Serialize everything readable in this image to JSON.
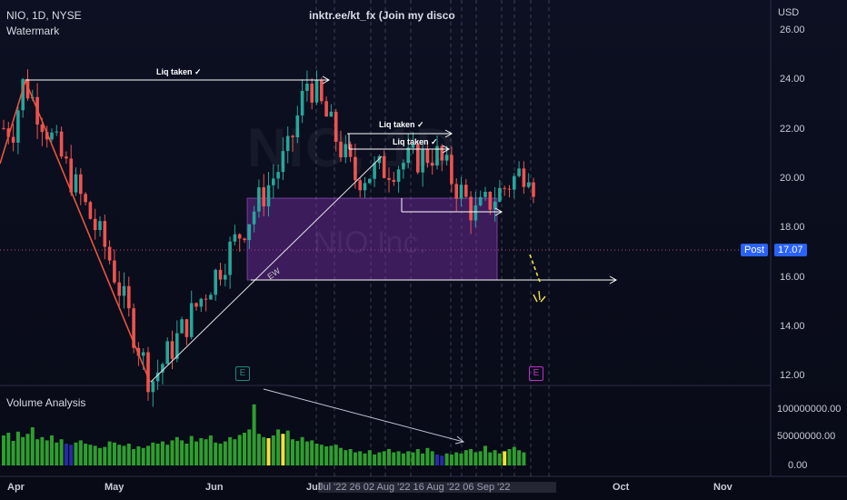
{
  "header": {
    "symbol_line": "NIO, 1D, NYSE",
    "watermark_label": "Watermark",
    "title_link": "inktr.ee/kt_fx (Join my disco",
    "currency": "USD"
  },
  "watermark": {
    "ticker": "NIO, 1D",
    "company": "NIO Inc."
  },
  "annotations": {
    "liq_taken_1": "Liq taken ✓",
    "liq_taken_2": "Liq taken ✓",
    "liq_taken_3": "Liq taken ✓",
    "ew_label": "EW",
    "earnings_1": "E",
    "earnings_2": "E"
  },
  "price_axis": {
    "ticks": [
      "26.00",
      "24.00",
      "22.00",
      "20.00",
      "18.00",
      "16.00",
      "14.00",
      "12.00"
    ]
  },
  "price_pill": {
    "label": "Post",
    "value": "17.07"
  },
  "volume_panel": {
    "title": "Volume Analysis",
    "ticks": [
      "100000000.00",
      "50000000.00",
      "0.00"
    ]
  },
  "time_axis": {
    "labels": [
      "Apr",
      "May",
      "Jun",
      "Jul",
      "Oct",
      "Nov"
    ],
    "dense_label": "Jul '22  26  02 Aug '22  16 Aug '22  06 Sep '22"
  },
  "colors": {
    "up": "#26a69a",
    "down": "#ef5350",
    "zone": "#7b2fa8",
    "vol_green": "#2e9e2e",
    "vol_blue": "#2a2aa6",
    "vol_yellow": "#f5e13a",
    "accent": "#2962ff"
  },
  "chart_data": {
    "type": "candlestick",
    "ylim": [
      11.5,
      27
    ],
    "ylabel": "USD",
    "points": [
      {
        "date": "Apr 1",
        "close": 22.0
      },
      {
        "date": "Apr 4",
        "close": 23.9
      },
      {
        "date": "Apr 29",
        "close": 17.0
      },
      {
        "date": "May 12",
        "close": 11.7
      },
      {
        "date": "Jun 22",
        "close": 21.0
      },
      {
        "date": "Jun 28",
        "close": 24.0
      },
      {
        "date": "Jul 12",
        "close": 20.0
      },
      {
        "date": "Aug 5",
        "close": 21.0
      },
      {
        "date": "Aug 17",
        "close": 18.5
      },
      {
        "date": "Sep 2",
        "close": 20.5
      },
      {
        "date": "Sep 9",
        "close": 17.07
      }
    ],
    "volume_series": [
      55,
      60,
      45,
      62,
      52,
      58,
      70,
      48,
      52,
      46,
      55,
      42,
      48,
      40,
      38,
      42,
      46,
      40,
      38,
      36,
      32,
      34,
      44,
      42,
      38,
      36,
      40,
      30,
      35,
      32,
      36,
      42,
      40,
      44,
      38,
      46,
      52,
      46,
      40,
      54,
      44,
      50,
      48,
      55,
      42,
      40,
      44,
      52,
      48,
      56,
      60,
      66,
      112,
      58,
      52,
      50,
      55,
      66,
      58,
      64,
      48,
      45,
      52,
      44,
      46,
      40,
      38,
      35,
      36,
      38,
      32,
      28,
      30,
      24,
      26,
      22,
      28,
      20,
      24,
      26,
      30,
      24,
      26,
      22,
      26,
      24,
      30,
      22,
      32,
      26,
      20,
      18,
      22,
      20,
      24,
      22,
      28,
      30,
      24,
      26,
      36,
      24,
      28,
      22,
      26,
      30,
      34,
      28,
      24
    ],
    "volume_colors": "gggggggggggggbbggggggggggggggggggggggggggggggggggggggggyggygggggggggggggggggggggggggggggggbbggggggggggggygggggg"
  }
}
